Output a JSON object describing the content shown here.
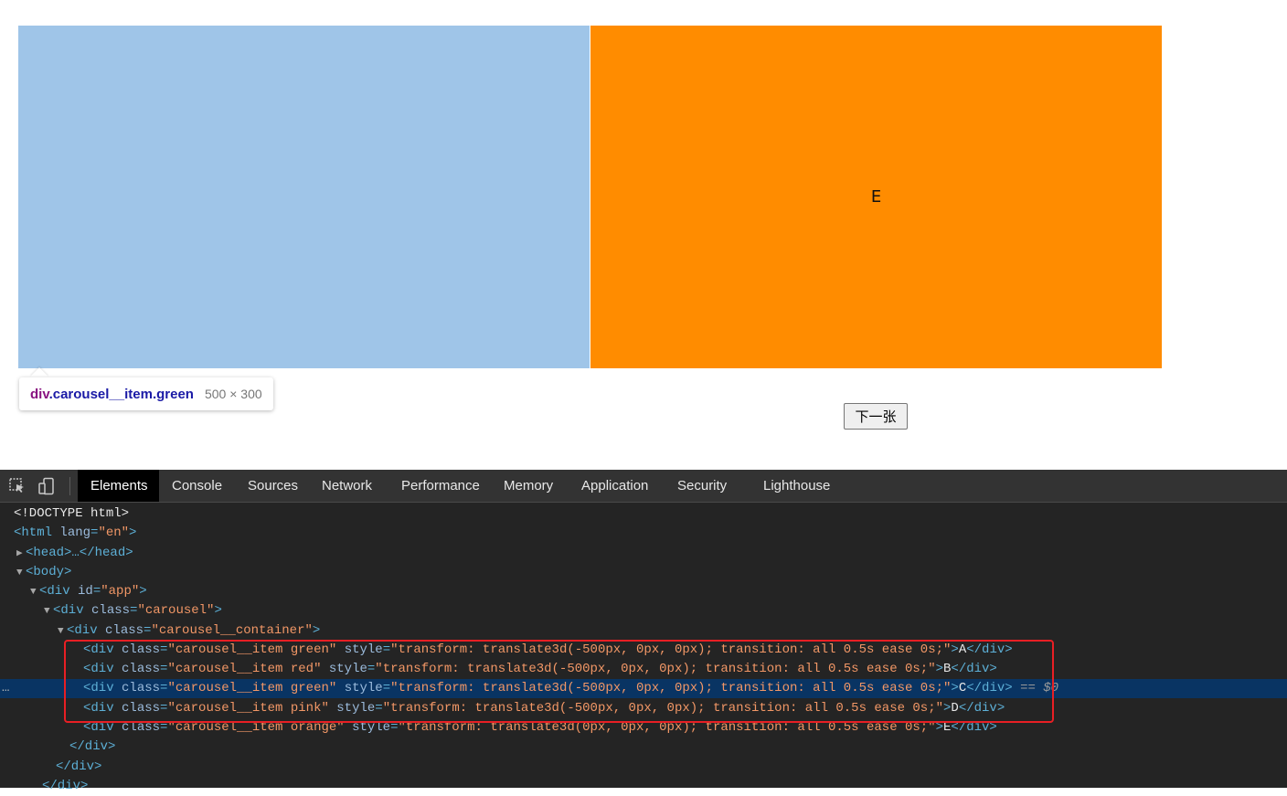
{
  "colors": {
    "item_left": "#9fc5e8",
    "item_right": "#ff8c00",
    "highlight_overlay": "rgba(111,168,220,0.66)",
    "devtools_bg": "#242424",
    "selected_row": "#093463",
    "annotation_box": "#e81f24"
  },
  "page": {
    "item_right_label": "E",
    "next_button_label": "下一张"
  },
  "tooltip": {
    "tag": "div",
    "class_selector": ".carousel__item.green",
    "dimensions": "500 × 300"
  },
  "devtools": {
    "icons": [
      "inspect-element-icon",
      "device-toolbar-icon"
    ],
    "tabs": [
      {
        "label": "Elements",
        "active": true
      },
      {
        "label": "Console"
      },
      {
        "label": "Sources"
      },
      {
        "label": "Network"
      },
      {
        "label": "Performance"
      },
      {
        "label": "Memory"
      },
      {
        "label": "Application"
      },
      {
        "label": "Security"
      },
      {
        "label": "Lighthouse"
      }
    ],
    "dom": {
      "doctype": "<!DOCTYPE html>",
      "html_open": "<html",
      "html_lang_attr": "lang",
      "html_lang_val": "\"en\"",
      "head_collapsed": "<head>…</head>",
      "body_open": "<body>",
      "app_open": "<div",
      "app_attr": "id",
      "app_val": "\"app\"",
      "carousel_open": "<div",
      "carousel_attr": "class",
      "carousel_val": "\"carousel\"",
      "container_open": "<div",
      "container_attr": "class",
      "container_val": "\"carousel__container\"",
      "items": [
        {
          "class": "\"carousel__item green\"",
          "style": "\"transform: translate3d(-500px, 0px, 0px); transition: all 0.5s ease 0s;\"",
          "text": "A"
        },
        {
          "class": "\"carousel__item red\"",
          "style": "\"transform: translate3d(-500px, 0px, 0px); transition: all 0.5s ease 0s;\"",
          "text": "B"
        },
        {
          "class": "\"carousel__item green\"",
          "style": "\"transform: translate3d(-500px, 0px, 0px); transition: all 0.5s ease 0s;\"",
          "text": "C",
          "selected": true
        },
        {
          "class": "\"carousel__item pink\"",
          "style": "\"transform: translate3d(-500px, 0px, 0px); transition: all 0.5s ease 0s;\"",
          "text": "D"
        },
        {
          "class": "\"carousel__item orange\"",
          "style": "\"transform: translate3d(0px, 0px, 0px); transition: all 0.5s ease 0s;\"",
          "text": "E"
        }
      ],
      "selected_marker": "== $0",
      "selected_dots": "…",
      "div_close": "</div>"
    }
  }
}
